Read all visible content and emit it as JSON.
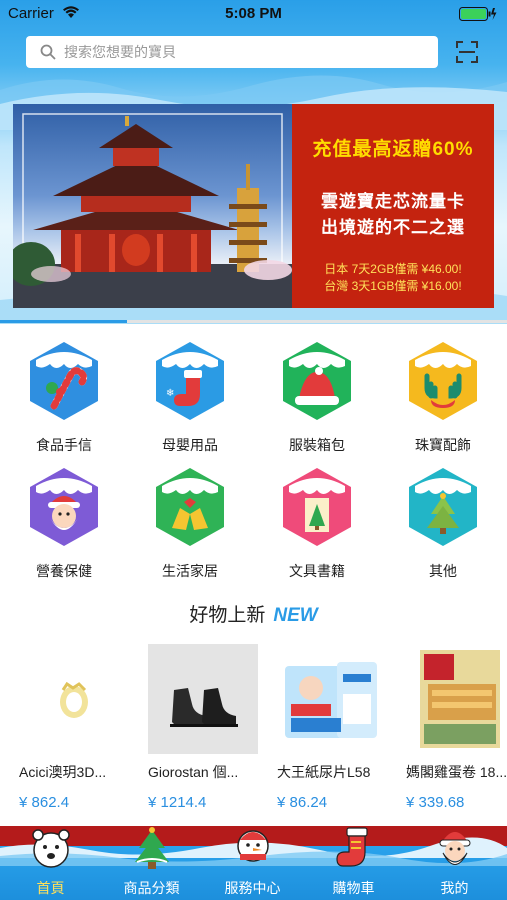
{
  "status_bar": {
    "carrier": "Carrier",
    "time": "5:08 PM"
  },
  "search": {
    "placeholder": "搜索您想要的寶貝"
  },
  "banner": {
    "headline": "充值最高返贈60%",
    "line1": "雲遊寶走芯流量卡",
    "line2": "出境遊的不二之選",
    "offer1": "日本 7天2GB僅需 ¥46.00!",
    "offer2": "台灣 3天1GB僅需 ¥16.00!",
    "carousel_progress": 0.25
  },
  "categories": [
    {
      "label": "食品手信",
      "icon": "candy-cane-icon",
      "color": "#2f8fe0"
    },
    {
      "label": "母嬰用品",
      "icon": "stocking-icon",
      "color": "#2b9be4"
    },
    {
      "label": "服裝箱包",
      "icon": "santa-hat-icon",
      "color": "#21b35a"
    },
    {
      "label": "珠寶配飾",
      "icon": "antlers-icon",
      "color": "#f5b91e"
    },
    {
      "label": "營養保健",
      "icon": "santa-face-icon",
      "color": "#7e5bd6"
    },
    {
      "label": "生活家居",
      "icon": "bells-icon",
      "color": "#2fb356"
    },
    {
      "label": "文具書籍",
      "icon": "christmas-card-icon",
      "color": "#ef4b7a"
    },
    {
      "label": "其他",
      "icon": "christmas-tree-icon",
      "color": "#22b5c7"
    }
  ],
  "new_section": {
    "title": "好物上新",
    "badge": "NEW"
  },
  "products": [
    {
      "name": "Acici澳玥3D...",
      "price": "¥ 862.4"
    },
    {
      "name": "Giorostan 個...",
      "price": "¥ 1214.4"
    },
    {
      "name": "大王紙尿片L58",
      "price": "¥ 86.24"
    },
    {
      "name": "媽閣雞蛋卷 18...",
      "price": "¥ 339.68"
    }
  ],
  "tabs": [
    {
      "label": "首頁",
      "icon": "polar-bear-icon",
      "active": true
    },
    {
      "label": "商品分類",
      "icon": "christmas-tree-icon",
      "active": false
    },
    {
      "label": "服務中心",
      "icon": "snowman-icon",
      "active": false
    },
    {
      "label": "購物車",
      "icon": "stocking-icon",
      "active": false
    },
    {
      "label": "我的",
      "icon": "santa-face-icon",
      "active": false
    }
  ]
}
